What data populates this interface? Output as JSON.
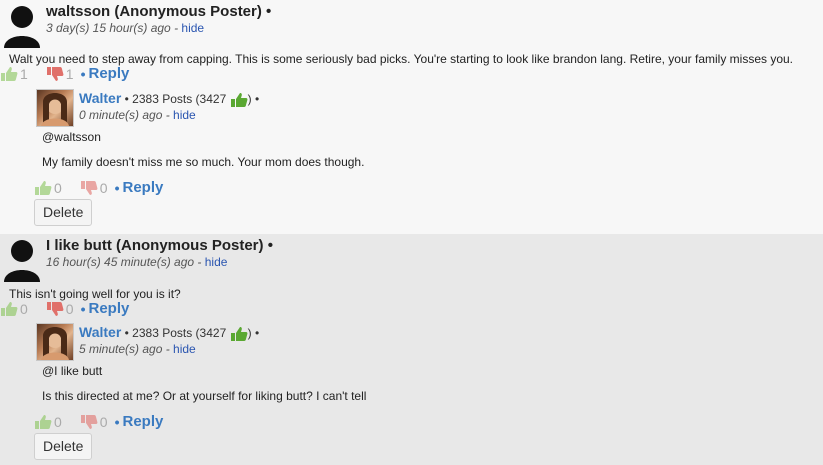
{
  "threads": [
    {
      "author": "waltsson (Anonymous Poster)",
      "time": "3 day(s) 15 hour(s) ago",
      "hide": "hide",
      "text": "Walt you need to step away from capping.  This is some seriously bad picks.  You're starting to look like brandon lang.  Retire, your family misses you.",
      "up": "1",
      "down": "1",
      "reply": "Reply",
      "response": {
        "name": "Walter",
        "posts": "2383 Posts (3427",
        "time": "0 minute(s) ago",
        "hide": "hide",
        "mention": "@waltsson",
        "text": "My family doesn't miss me so much. Your mom does though.",
        "up": "0",
        "down": "0",
        "reply": "Reply",
        "delete": "Delete"
      }
    },
    {
      "author": "I like butt (Anonymous Poster)",
      "time": "16 hour(s) 45 minute(s) ago",
      "hide": "hide",
      "text": "This isn't going well for you is it?",
      "up": "0",
      "down": "0",
      "reply": "Reply",
      "response": {
        "name": "Walter",
        "posts": "2383 Posts (3427",
        "time": "5 minute(s) ago",
        "hide": "hide",
        "mention": "@I like butt",
        "text": "Is this directed at me? Or at yourself for liking butt? I can't tell",
        "up": "0",
        "down": "0",
        "reply": "Reply",
        "delete": "Delete"
      }
    }
  ],
  "colors": {
    "link": "#3a7ac0",
    "thumb_up": "#7cbf4a",
    "thumb_down": "#e0706a"
  },
  "separators": {
    "bullet": "•",
    "close_paren": ")"
  }
}
